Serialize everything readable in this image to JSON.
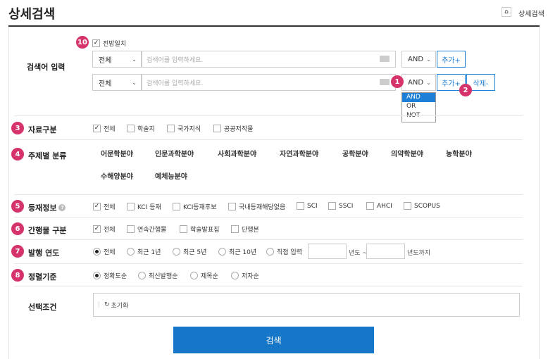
{
  "page": {
    "title": "상세검색",
    "breadcrumb": "상세검색"
  },
  "query": {
    "label": "검색어 입력",
    "exact_match": "전방일치",
    "rows": [
      {
        "field": "전체",
        "placeholder": "검색어를 입력하세요.",
        "op": "AND",
        "add": "추가+"
      },
      {
        "field": "전체",
        "placeholder": "검색어를 입력하세요.",
        "op": "AND",
        "add": "추가+",
        "delete": "삭제-"
      }
    ],
    "op_options": [
      "AND",
      "OR",
      "NOT"
    ]
  },
  "badges": {
    "b1": "1",
    "b2": "2",
    "b3": "3",
    "b4": "4",
    "b5": "5",
    "b6": "6",
    "b7": "7",
    "b8": "8",
    "b10": "10"
  },
  "resource_type": {
    "label": "자료구분",
    "options": [
      "전체",
      "학술지",
      "국가지식",
      "공공저작물"
    ]
  },
  "subject": {
    "label": "주제별 분류",
    "items": [
      "어문학분야",
      "인문과학분야",
      "사회과학분야",
      "자연과학분야",
      "공학분야",
      "의약학분야",
      "농학분야",
      "수해양분야",
      "예체능분야"
    ]
  },
  "listing": {
    "label": "등재정보",
    "help": "?",
    "options": [
      "전체",
      "KCI 등재",
      "KCI등재후보",
      "국내등재해당없음",
      "SCI",
      "SSCI",
      "AHCI",
      "SCOPUS"
    ]
  },
  "pub_type": {
    "label": "간행물 구분",
    "options": [
      "전체",
      "연속간행물",
      "학술발표집",
      "단행본"
    ]
  },
  "year": {
    "label": "발행 연도",
    "options": [
      "전체",
      "최근 1년",
      "최근 5년",
      "최근 10년",
      "직접 입력"
    ],
    "from_suffix": "년도 ~",
    "to_suffix": "년도까지"
  },
  "sort": {
    "label": "정렬기준",
    "options": [
      "정확도순",
      "최신발행순",
      "제목순",
      "저자순"
    ]
  },
  "selected": {
    "label": "선택조건",
    "reset": "초기화"
  },
  "search_button": "검색",
  "colors": {
    "accent": "#1e7fd6",
    "badge": "#d6336c",
    "primary_button": "#1676c7"
  }
}
